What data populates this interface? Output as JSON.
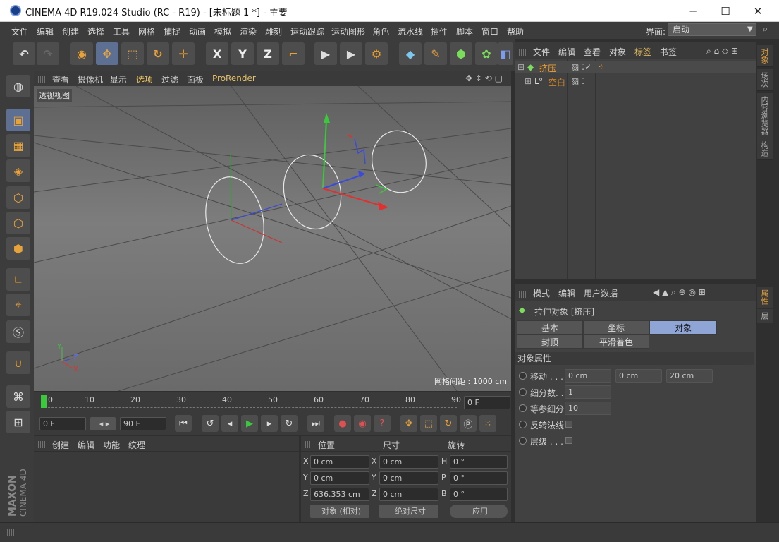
{
  "title": "CINEMA 4D R19.024 Studio (RC - R19) - [未标题 1 *] - 主要",
  "window_controls": {
    "minimize": "─",
    "maximize": "☐",
    "close": "✕"
  },
  "menu": [
    "文件",
    "编辑",
    "创建",
    "选择",
    "工具",
    "网格",
    "捕捉",
    "动画",
    "模拟",
    "渲染",
    "雕刻",
    "运动跟踪",
    "运动图形",
    "角色",
    "流水线",
    "插件",
    "脚本",
    "窗口",
    "帮助"
  ],
  "layout_label": "界面:",
  "layout_value": "启动",
  "toolbar": {
    "x": "X",
    "y": "Y",
    "z": "Z"
  },
  "viewport": {
    "menu": [
      "查看",
      "摄像机",
      "显示",
      "选项",
      "过滤",
      "面板",
      "ProRender"
    ],
    "label": "透视视图",
    "grid_info": "网格间距 : 1000 cm",
    "axis": {
      "y": "Y",
      "z": "Z",
      "x": "X"
    }
  },
  "timeline": {
    "ticks": [
      "0",
      "10",
      "20",
      "30",
      "40",
      "50",
      "60",
      "70",
      "80",
      "90"
    ],
    "current_frame": "0 F"
  },
  "transport": {
    "start": "0 F",
    "end": "90 F"
  },
  "material_panel": {
    "menu": [
      "创建",
      "编辑",
      "功能",
      "纹理"
    ]
  },
  "coord_panel": {
    "headers": [
      "位置",
      "尺寸",
      "旋转"
    ],
    "rows": [
      {
        "a": "X",
        "pos": "0 cm",
        "b": "X",
        "size": "0 cm",
        "c": "H",
        "rot": "0 °"
      },
      {
        "a": "Y",
        "pos": "0 cm",
        "b": "Y",
        "size": "0 cm",
        "c": "P",
        "rot": "0 °"
      },
      {
        "a": "Z",
        "pos": "636.353 cm",
        "b": "Z",
        "size": "0 cm",
        "c": "B",
        "rot": "0 °"
      }
    ],
    "mode": "对象 (相对)",
    "size_mode": "绝对尺寸",
    "apply": "应用"
  },
  "object_manager": {
    "menu": [
      "文件",
      "编辑",
      "查看",
      "对象",
      "标签",
      "书签"
    ],
    "items": [
      {
        "name": "挤压",
        "color": "#f0a030"
      },
      {
        "name": "空白",
        "color": "#d08020"
      }
    ]
  },
  "attributes": {
    "menu": [
      "模式",
      "编辑",
      "用户数据"
    ],
    "object_title": "拉伸对象 [挤压]",
    "tabs_row1": [
      "基本",
      "坐标",
      "对象"
    ],
    "tabs_row2": [
      "封顶",
      "平滑着色(Phong)"
    ],
    "section": "对象属性",
    "fields": [
      {
        "label": "移动 . . .",
        "v1": "0 cm",
        "v2": "0 cm",
        "v3": "20 cm"
      },
      {
        "label": "细分数. .",
        "v1": "1"
      },
      {
        "label": "等参细分",
        "v1": "10"
      },
      {
        "label": "反转法线"
      },
      {
        "label": "层级 . . ."
      }
    ]
  },
  "right_tabs": {
    "top": [
      "对象",
      "场次",
      "内容浏览器",
      "构造"
    ],
    "bottom": [
      "属性",
      "层"
    ]
  },
  "brand": {
    "line1": "MAXON",
    "line2": "CINEMA 4D"
  },
  "accent": "#e8a23a",
  "tab_active": "#8fa5d6"
}
